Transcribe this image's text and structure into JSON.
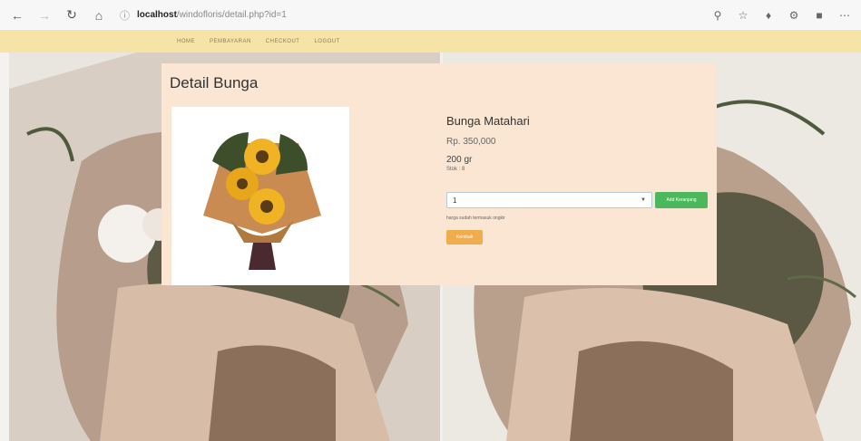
{
  "browser": {
    "url_host": "localhost",
    "url_path": "/windofloris/detail.php?id=1"
  },
  "nav": {
    "items": [
      "HOME",
      "PEMBAYARAN",
      "CHECKOUT",
      "LOGOUT"
    ]
  },
  "card": {
    "title": "Detail Bunga",
    "product_name": "Bunga Matahari",
    "price": "Rp. 350,000",
    "weight": "200 gr",
    "stock": "Stok : 8",
    "qty_value": "1",
    "add_button": "Add Keranjang",
    "note": "harga sudah termasuk ongkir",
    "back_button": "Kembali"
  },
  "colors": {
    "navbar": "#f6e4a6",
    "card_bg": "#fae6d2",
    "add_button": "#4cb85c",
    "back_button": "#f0ad4e"
  }
}
